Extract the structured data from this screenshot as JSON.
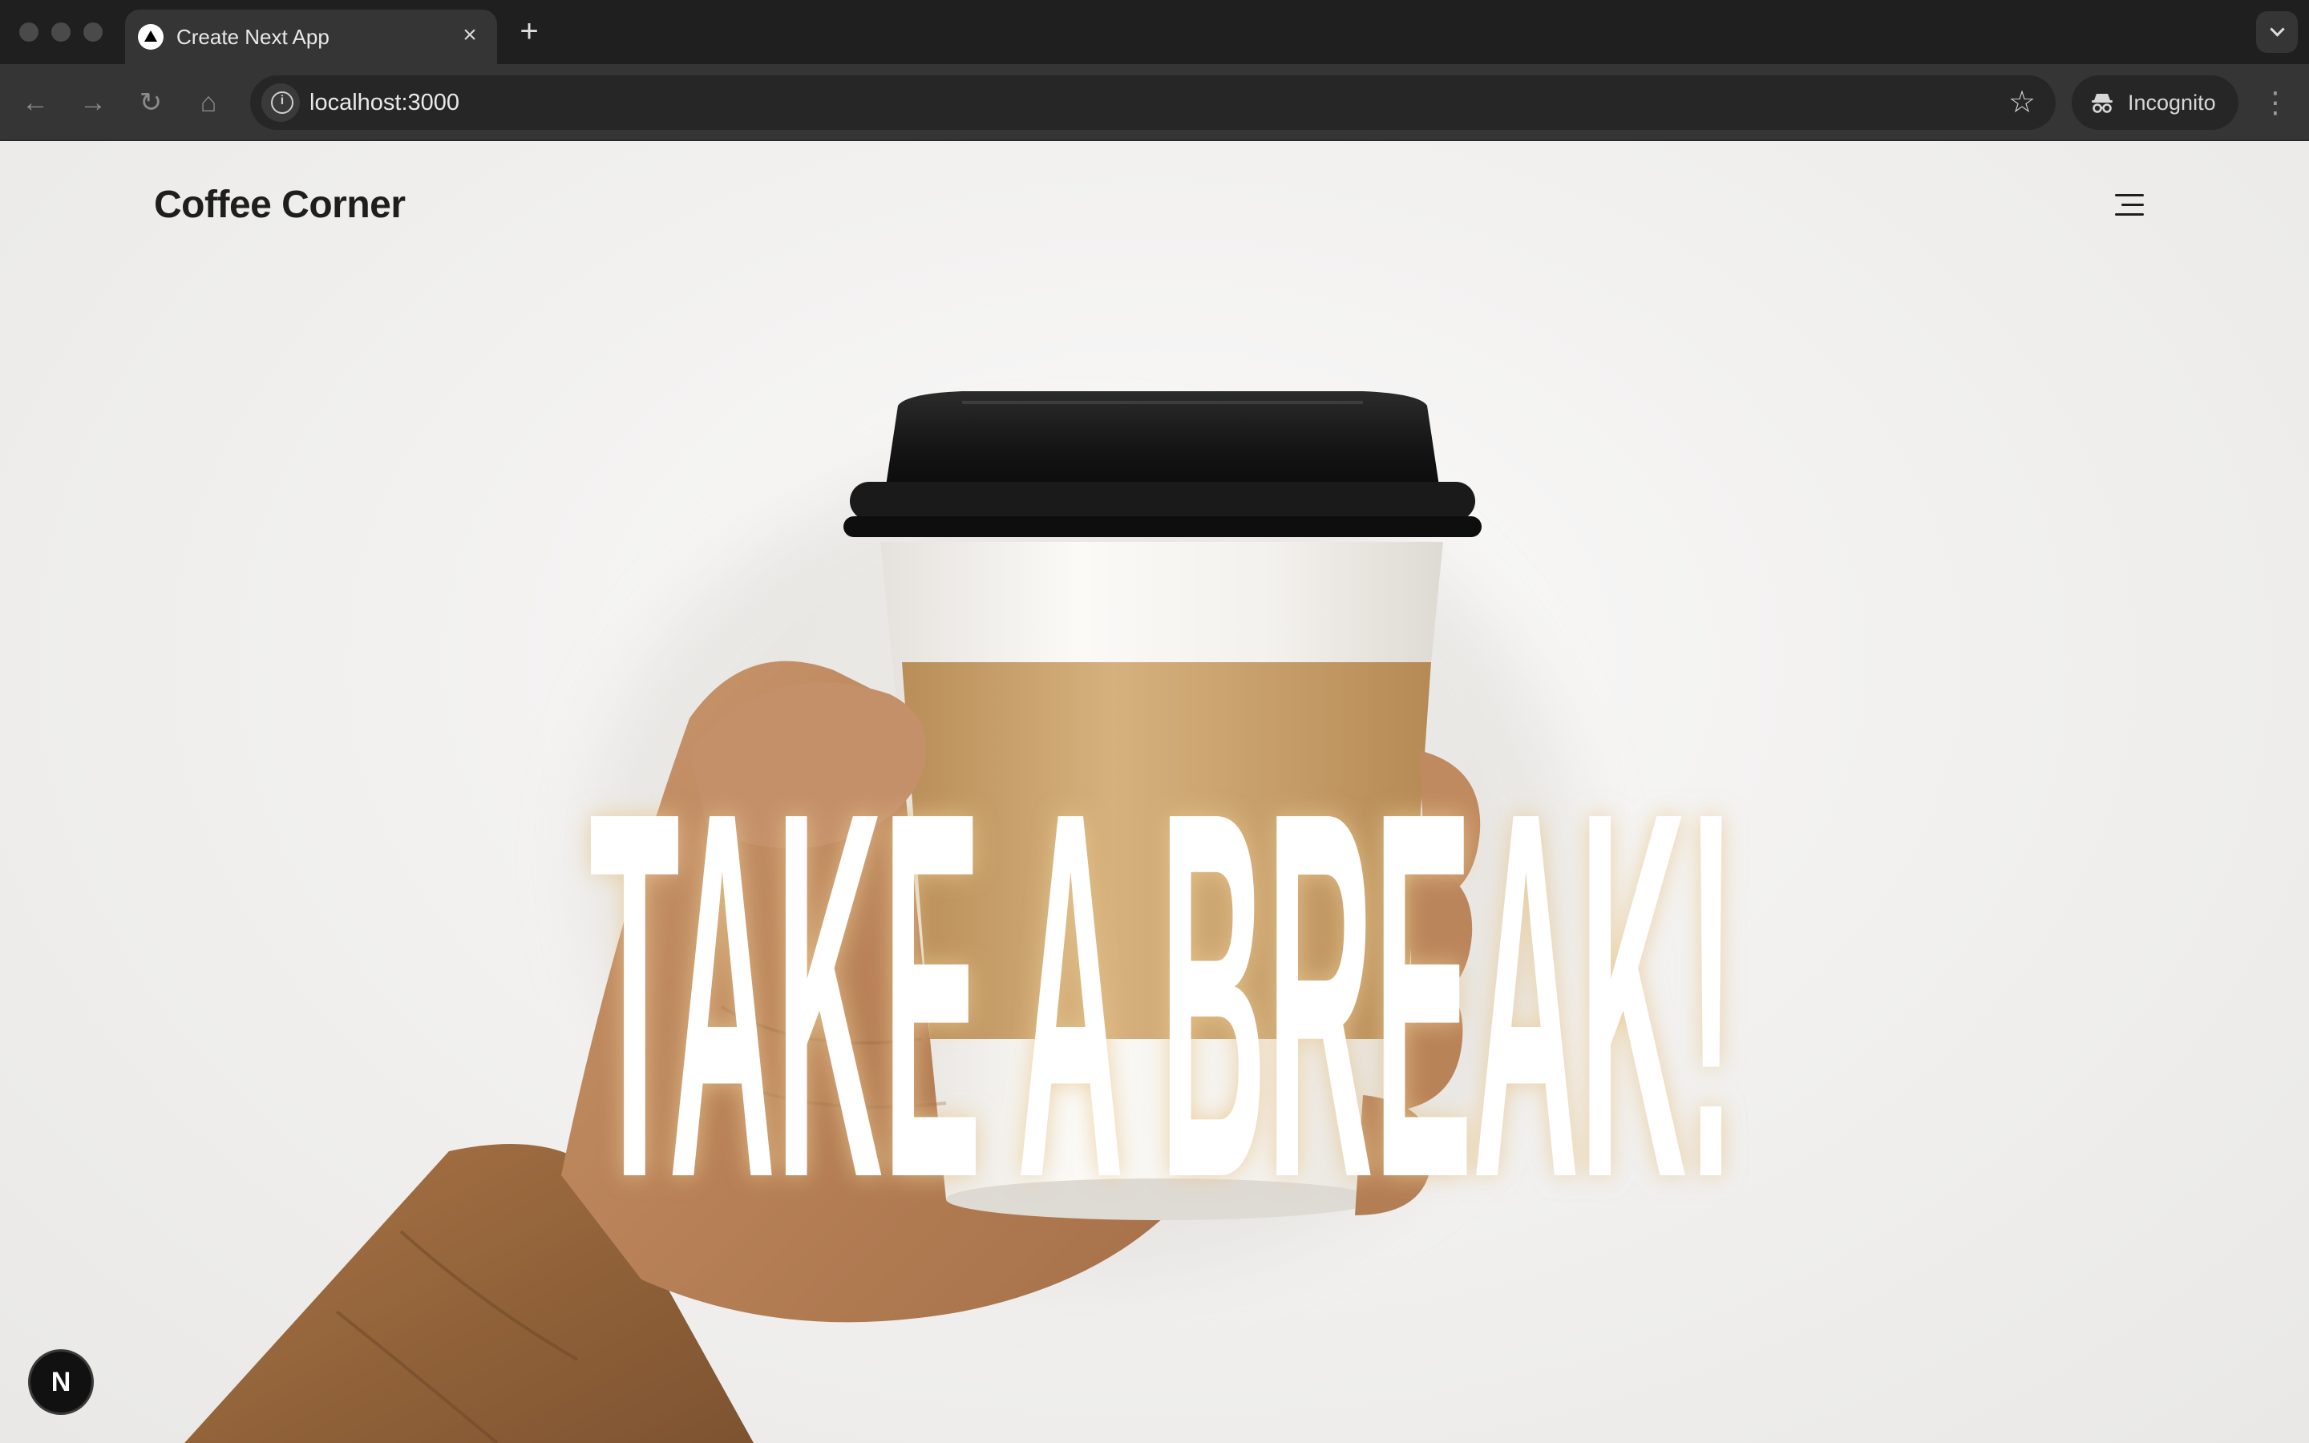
{
  "browser": {
    "tab": {
      "title": "Create Next App",
      "close_glyph": "×"
    },
    "new_tab_glyph": "+",
    "toolbar": {
      "back_glyph": "←",
      "forward_glyph": "→",
      "reload_glyph": "↻",
      "home_glyph": "⌂",
      "url": "localhost:3000",
      "bookmark_glyph": "☆",
      "profile_label": "Incognito",
      "menu_glyph": "⋮"
    }
  },
  "site": {
    "brand": "Coffee Corner",
    "hero_headline": "TAKE A BREAK!"
  },
  "dev_overlay": {
    "badge_label": "N"
  },
  "colors": {
    "chrome_dark": "#1f1f1f",
    "chrome_toolbar": "#353535",
    "page_bg": "#f0efee",
    "cup_lid": "#1c1c1c",
    "cup_sleeve": "#c9a16a",
    "sleeve_jacket": "#9a6b3f",
    "headline": "#ffffff"
  },
  "icons": [
    "tab-favicon",
    "close-icon",
    "plus-icon",
    "back-arrow-icon",
    "forward-arrow-icon",
    "reload-icon",
    "home-icon",
    "info-icon",
    "star-icon",
    "incognito-icon",
    "kebab-menu-icon",
    "hamburger-menu-icon"
  ]
}
